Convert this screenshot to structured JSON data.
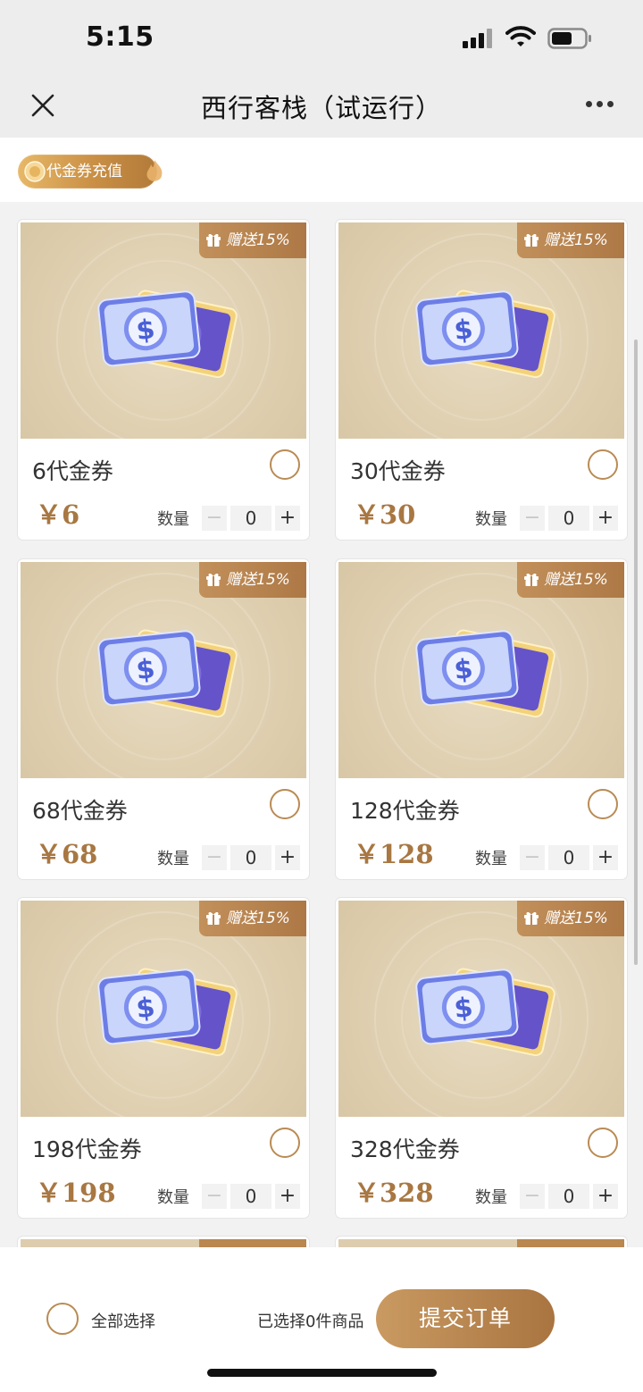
{
  "status_bar": {
    "time": "5:15"
  },
  "nav": {
    "title": "西行客栈（试运行）"
  },
  "category": {
    "label": "代金券充值"
  },
  "product_badge": "赠送15%",
  "quantity_label": "数量",
  "products": [
    {
      "name": "6代金券",
      "price": "￥6",
      "quantity": "0",
      "minus": "−",
      "plus": "+"
    },
    {
      "name": "30代金券",
      "price": "￥30",
      "quantity": "0",
      "minus": "−",
      "plus": "+"
    },
    {
      "name": "68代金券",
      "price": "￥68",
      "quantity": "0",
      "minus": "−",
      "plus": "+"
    },
    {
      "name": "128代金券",
      "price": "￥128",
      "quantity": "0",
      "minus": "−",
      "plus": "+"
    },
    {
      "name": "198代金券",
      "price": "￥198",
      "quantity": "0",
      "minus": "−",
      "plus": "+"
    },
    {
      "name": "328代金券",
      "price": "￥328",
      "quantity": "0",
      "minus": "−",
      "plus": "+"
    }
  ],
  "footer": {
    "select_all_label": "全部选择",
    "selected_summary": "已选择0件商品",
    "submit_label": "提交订单"
  },
  "colors": {
    "accent": "#b98b54",
    "price": "#a87742",
    "badge": "#b9874f",
    "submit_start": "#c99a62",
    "submit_end": "#a97440"
  }
}
